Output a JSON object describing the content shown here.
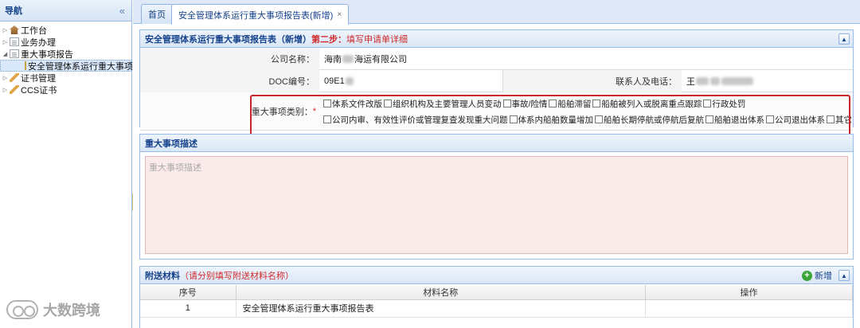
{
  "sidebar": {
    "title": "导航",
    "collapse_icon": "«",
    "items": [
      {
        "label": "工作台",
        "icon": "home-icon"
      },
      {
        "label": "业务办理",
        "icon": "document-icon"
      },
      {
        "label": "重大事项报告",
        "icon": "document-icon"
      },
      {
        "label": "安全管理体系运行重大事项",
        "icon": "form-icon"
      },
      {
        "label": "证书管理",
        "icon": "pen-icon"
      },
      {
        "label": "CCS证书",
        "icon": "pen-icon"
      }
    ]
  },
  "tabs": [
    {
      "label": "首页"
    },
    {
      "label": "安全管理体系运行重大事项报告表(新增)",
      "close": "×"
    }
  ],
  "form": {
    "title": "安全管理体系运行重大事项报告表（新增）",
    "step": "第二步：",
    "hint": "填写申请单详细",
    "collapse_icon": "▲",
    "company_label": "公司名称：",
    "company_value_prefix": "海南",
    "company_value_suffix": "海运有限公司",
    "doc_label": "DOC编号：",
    "doc_value": "09E1",
    "contact_label": "联系人及电话：",
    "contact_value": "王",
    "category_label": "重大事项类别：",
    "required_mark": "*",
    "categories_line1": [
      "体系文件改版",
      "组织机构及主要管理人员变动",
      "事故/险情",
      "船舶滞留",
      "船舶被列入或脱离重点跟踪",
      "行政处罚"
    ],
    "categories_line2": [
      "公司内审、有效性评价或管理复查发现重大问题",
      "体系内船舶数量增加",
      "船舶长期停航或停航后复航",
      "船舶退出体系",
      "公司退出体系",
      "其它"
    ]
  },
  "description": {
    "title": "重大事项描述",
    "placeholder": "重大事项描述"
  },
  "attachments": {
    "title": "附送材料",
    "note": "（请分别填写附送材料名称）",
    "add_label": "新增",
    "columns": [
      "序号",
      "材料名称",
      "操作"
    ],
    "rows": [
      {
        "index": "1",
        "name": "安全管理体系运行重大事项报告表",
        "action": ""
      }
    ]
  },
  "watermark": "大数跨境"
}
